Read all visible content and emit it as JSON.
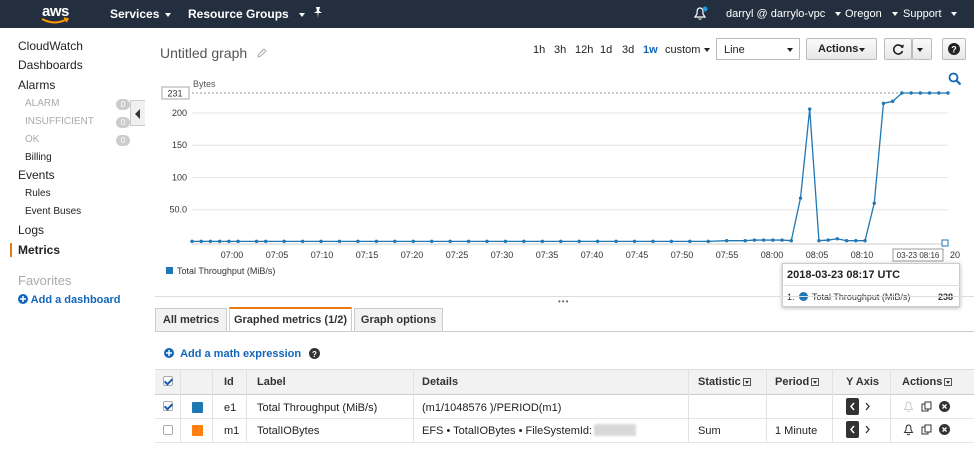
{
  "topnav": {
    "logo_text": "aws",
    "services": "Services",
    "resource_groups": "Resource Groups",
    "user": "darryl @ darrylo-vpc",
    "region": "Oregon",
    "support": "Support"
  },
  "sidebar": {
    "cloudwatch": "CloudWatch",
    "dashboards": "Dashboards",
    "alarms": "Alarms",
    "alarm": "ALARM",
    "alarm_count": "0",
    "insufficient": "INSUFFICIENT",
    "insufficient_count": "0",
    "ok": "OK",
    "ok_count": "0",
    "billing": "Billing",
    "events": "Events",
    "rules": "Rules",
    "event_buses": "Event Buses",
    "logs": "Logs",
    "metrics": "Metrics",
    "favorites": "Favorites",
    "add_dashboard": "Add a dashboard"
  },
  "header": {
    "title": "Untitled graph",
    "ranges": [
      "1h",
      "3h",
      "12h",
      "1d",
      "3d",
      "1w"
    ],
    "selected_range": "1w",
    "custom": "custom",
    "chart_type": "Line",
    "actions": "Actions"
  },
  "chart_data": {
    "type": "line",
    "ylabel": "Bytes",
    "yticks": [
      "50.0",
      "100",
      "150",
      "200"
    ],
    "ylim": [
      0,
      231
    ],
    "max_marker": "231",
    "xticks": [
      "07:00",
      "07:05",
      "07:10",
      "07:15",
      "07:20",
      "07:25",
      "07:30",
      "07:35",
      "07:40",
      "07:45",
      "07:50",
      "07:55",
      "08:00",
      "08:05",
      "08:10"
    ],
    "x_end_label": "20",
    "cursor_label": "03-23 08:16",
    "series": [
      {
        "name": "Total Throughput (MiB/s)",
        "color": "#1f77b4",
        "x": [
          0,
          1,
          2,
          3,
          4,
          5,
          7,
          8,
          10,
          12,
          14,
          16,
          18,
          20,
          22,
          24,
          26,
          28,
          30,
          32,
          34,
          36,
          38,
          40,
          42,
          44,
          46,
          48,
          50,
          52,
          54,
          56,
          58,
          60,
          61,
          62,
          63,
          64,
          65,
          66,
          67,
          68,
          69,
          70,
          71,
          72,
          73,
          74,
          75,
          76,
          77,
          78,
          79,
          80,
          81,
          82
        ],
        "y": [
          1,
          1,
          1,
          1,
          1,
          1,
          1,
          1,
          1,
          1,
          1,
          1,
          1,
          1,
          1,
          1,
          1,
          1,
          1,
          1,
          1,
          1,
          1,
          1,
          1,
          1,
          1,
          1,
          1,
          1,
          1,
          1,
          2,
          2,
          3,
          3,
          3,
          3,
          2,
          68,
          206,
          2,
          3,
          5,
          2,
          2,
          2,
          60,
          215,
          218,
          231,
          231,
          231,
          231,
          231,
          231
        ]
      }
    ],
    "legend": "bottom-left"
  },
  "tooltip": {
    "time": "2018-03-23 08:17 UTC",
    "index": "1.",
    "series": "Total Throughput (MiB/s)",
    "value": "238"
  },
  "tabs": [
    "All metrics",
    "Graphed metrics (1/2)",
    "Graph options"
  ],
  "math": {
    "label": "Add a math expression"
  },
  "table": {
    "headers": {
      "id": "Id",
      "label": "Label",
      "details": "Details",
      "statistic": "Statistic",
      "period": "Period",
      "yaxis": "Y Axis",
      "actions": "Actions"
    },
    "rows": [
      {
        "checked": true,
        "color": "#1f77b4",
        "id": "e1",
        "label": "Total Throughput (MiB/s)",
        "details": "(m1/1048576 )/PERIOD(m1)",
        "statistic": "",
        "period": ""
      },
      {
        "checked": false,
        "color": "#ff7f0e",
        "id": "m1",
        "label": "TotalIOBytes",
        "details": "EFS • TotalIOBytes • FileSystemId: fs-",
        "statistic": "Sum",
        "period": "1 Minute"
      }
    ]
  }
}
